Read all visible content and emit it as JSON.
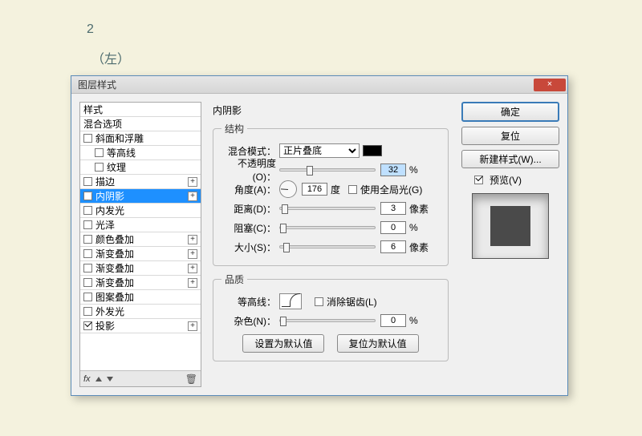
{
  "page": {
    "outer1": "2",
    "outer2": "（左）"
  },
  "dialog": {
    "title": "图层样式",
    "close": "×",
    "sidebar": {
      "header": "样式",
      "items": [
        {
          "label": "混合选项",
          "checked": null,
          "indent": false,
          "plus": false
        },
        {
          "label": "斜面和浮雕",
          "checked": false,
          "indent": false,
          "plus": false
        },
        {
          "label": "等高线",
          "checked": false,
          "indent": true,
          "plus": false
        },
        {
          "label": "纹理",
          "checked": false,
          "indent": true,
          "plus": false
        },
        {
          "label": "描边",
          "checked": false,
          "indent": false,
          "plus": true
        },
        {
          "label": "内阴影",
          "checked": true,
          "indent": false,
          "plus": true,
          "selected": true
        },
        {
          "label": "内发光",
          "checked": false,
          "indent": false,
          "plus": false
        },
        {
          "label": "光泽",
          "checked": false,
          "indent": false,
          "plus": false
        },
        {
          "label": "颜色叠加",
          "checked": false,
          "indent": false,
          "plus": true
        },
        {
          "label": "渐变叠加",
          "checked": false,
          "indent": false,
          "plus": true
        },
        {
          "label": "渐变叠加",
          "checked": false,
          "indent": false,
          "plus": true
        },
        {
          "label": "渐变叠加",
          "checked": false,
          "indent": false,
          "plus": true
        },
        {
          "label": "图案叠加",
          "checked": false,
          "indent": false,
          "plus": false
        },
        {
          "label": "外发光",
          "checked": false,
          "indent": false,
          "plus": false
        },
        {
          "label": "投影",
          "checked": true,
          "indent": false,
          "plus": true
        }
      ],
      "fx": "fx"
    },
    "panel": {
      "title": "内阴影",
      "group_structure": "结构",
      "blend_label": "混合模式：",
      "blend_value": "正片叠底",
      "opacity_label": "不透明度(O)：",
      "opacity_value": "32",
      "opacity_unit": "%",
      "angle_label": "角度(A)：",
      "angle_value": "176",
      "angle_unit": "度",
      "global_light": "使用全局光(G)",
      "distance_label": "距离(D)：",
      "distance_value": "3",
      "distance_unit": "像素",
      "choke_label": "阻塞(C)：",
      "choke_value": "0",
      "choke_unit": "%",
      "size_label": "大小(S)：",
      "size_value": "6",
      "size_unit": "像素",
      "group_quality": "品质",
      "contour_label": "等高线：",
      "antialias": "消除锯齿(L)",
      "noise_label": "杂色(N)：",
      "noise_value": "0",
      "noise_unit": "%",
      "make_default": "设置为默认值",
      "reset_default": "复位为默认值"
    },
    "right": {
      "ok": "确定",
      "reset": "复位",
      "newstyle": "新建样式(W)...",
      "preview": "预览(V)"
    }
  }
}
